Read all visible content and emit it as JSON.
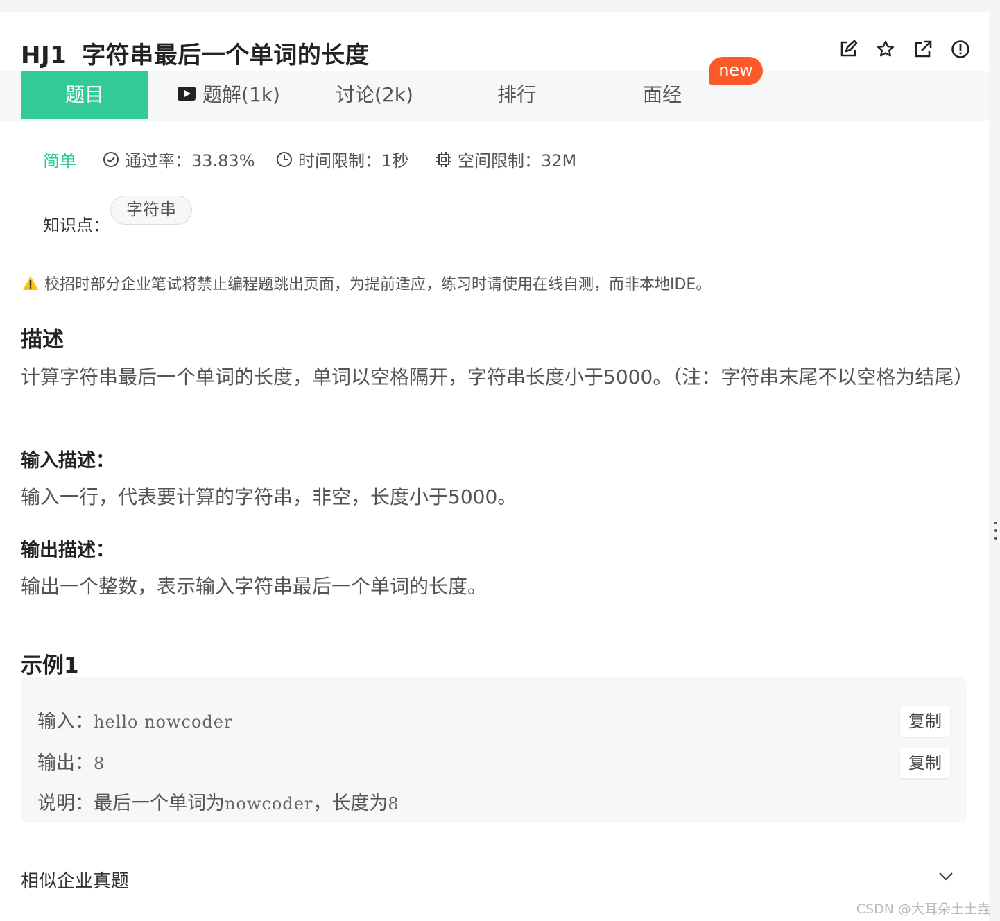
{
  "problem": {
    "code": "HJ1",
    "title": "字符串最后一个单词的长度"
  },
  "top_icons": [
    "edit-icon",
    "star-icon",
    "share-icon",
    "report-icon"
  ],
  "tabs": [
    {
      "label": "题目",
      "active": true
    },
    {
      "label": "题解(1k)",
      "icon": "video-icon"
    },
    {
      "label": "讨论(2k)"
    },
    {
      "label": "排行"
    },
    {
      "label": "面经"
    }
  ],
  "new_badge": "new",
  "meta": {
    "difficulty": "简单",
    "pass_rate": "通过率：33.83%",
    "time_limit": "时间限制：1秒",
    "memory_limit": "空间限制：32M"
  },
  "knowledge": {
    "label": "知识点：",
    "tags": [
      "字符串"
    ]
  },
  "warning": "校招时部分企业笔试将禁止编程题跳出页面，为提前适应，练习时请使用在线自测，而非本地IDE。",
  "description": {
    "heading": "描述",
    "text": "计算字符串最后一个单词的长度，单词以空格隔开，字符串长度小于5000。（注：字符串末尾不以空格为结尾）"
  },
  "input_desc": {
    "heading": "输入描述：",
    "text": "输入一行，代表要计算的字符串，非空，长度小于5000。"
  },
  "output_desc": {
    "heading": "输出描述：",
    "text": "输出一个整数，表示输入字符串最后一个单词的长度。"
  },
  "example": {
    "heading": "示例1",
    "input_label": "输入：",
    "input_value": "hello nowcoder",
    "output_label": "输出：",
    "output_value": "8",
    "note_label": "说明：",
    "note_text1": "最后一个单词为",
    "note_code1": "nowcoder",
    "note_text2": "，长度为",
    "note_code2": "8",
    "copy_label": "复制"
  },
  "similar": "相似企业真题",
  "watermark": "CSDN @大耳朵土土垚",
  "colors": {
    "accent": "#32ca99",
    "badge": "#fa5a28",
    "warning": "#f5c518"
  }
}
